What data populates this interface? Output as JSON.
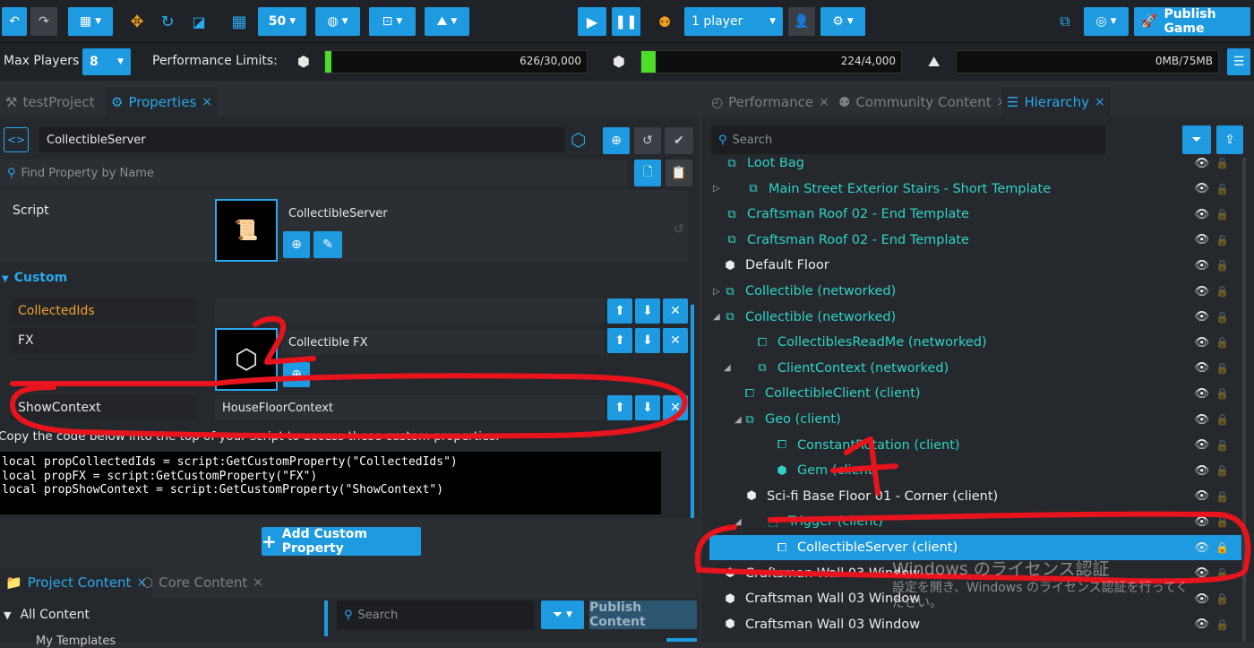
{
  "toolbar": {
    "grid_size": "50",
    "player_mode": "1 player",
    "publish_label": "Publish Game"
  },
  "perf": {
    "max_players_label": "Max Players",
    "max_players_value": "8",
    "limits_label": "Performance Limits:",
    "objects": "626/30,000",
    "objects_fraction": 0.021,
    "networked": "224/4,000",
    "networked_fraction": 0.056,
    "memory": "0MB/75MB",
    "memory_fraction": 0.0
  },
  "left_tabs": {
    "project": "testProject",
    "properties": "Properties",
    "close": "×"
  },
  "properties": {
    "object_name": "CollectibleServer",
    "find_placeholder": "Find Property by Name",
    "script_label": "Script",
    "script_value": "CollectibleServer",
    "custom_header": "Custom",
    "custom": [
      {
        "name": "CollectedIds",
        "value": ""
      },
      {
        "name": "FX",
        "value": "Collectible FX"
      },
      {
        "name": "ShowContext",
        "value": "HouseFloorContext"
      }
    ],
    "copy_note": "Copy the code below into the top of your script to access these custom properties.",
    "code": "local propCollectedIds = script:GetCustomProperty(\"CollectedIds\")\nlocal propFX = script:GetCustomProperty(\"FX\")\nlocal propShowContext = script:GetCustomProperty(\"ShowContext\")",
    "add_button": "Add Custom Property"
  },
  "bottom_tabs": {
    "project_content": "Project Content",
    "core_content": "Core Content",
    "all_content": "All Content",
    "my_templates": "My Templates",
    "search_placeholder": "Search",
    "publish_content": "Publish Content"
  },
  "right_tabs": {
    "performance": "Performance",
    "community": "Community Content",
    "hierarchy": "Hierarchy"
  },
  "hierarchy": {
    "search_placeholder": "Search",
    "items": [
      {
        "label": "Loot Bag",
        "color": "teal",
        "icon": "folder-icon"
      },
      {
        "label": "Main Street Exterior Stairs - Short Template",
        "color": "teal",
        "icon": "folder-icon"
      },
      {
        "label": "Craftsman Roof 02 - End Template",
        "color": "teal",
        "icon": "folder-icon"
      },
      {
        "label": "Craftsman Roof 02 - End Template",
        "color": "teal",
        "icon": "folder-icon"
      },
      {
        "label": "Default Floor",
        "color": "white",
        "icon": "cube-icon"
      },
      {
        "label": "Collectible (networked)",
        "color": "teal",
        "icon": "folder-icon"
      },
      {
        "label": "Collectible (networked)",
        "color": "teal",
        "icon": "folder-icon"
      },
      {
        "label": "CollectiblesReadMe (networked)",
        "color": "teal",
        "icon": "script-icon"
      },
      {
        "label": "ClientContext (networked)",
        "color": "teal",
        "icon": "folder-icon"
      },
      {
        "label": "CollectibleClient (client)",
        "color": "teal",
        "icon": "script-icon"
      },
      {
        "label": "Geo (client)",
        "color": "teal",
        "icon": "folder-icon"
      },
      {
        "label": "ConstantRotation (client)",
        "color": "teal",
        "icon": "script-icon"
      },
      {
        "label": "Gem (client)",
        "color": "teal",
        "icon": "cube-icon"
      },
      {
        "label": "Sci-fi Base Floor 01 - Corner (client)",
        "color": "white",
        "icon": "cube-icon"
      },
      {
        "label": "Trigger (client)",
        "color": "teal",
        "icon": "trigger-icon"
      },
      {
        "label": "CollectibleServer (client)",
        "color": "selected",
        "icon": "script-icon"
      },
      {
        "label": "Craftsman Wall 03 Window",
        "color": "white",
        "icon": "cube-icon"
      },
      {
        "label": "Craftsman Wall 03 Window",
        "color": "white",
        "icon": "cube-icon"
      },
      {
        "label": "Craftsman Wall 03 Window",
        "color": "white",
        "icon": "cube-icon"
      }
    ]
  },
  "annotations": {
    "mark_1": "1",
    "mark_2": "2"
  },
  "watermark": {
    "line1": "Windows のライセンス認証",
    "line2": "設定を開き、Windows のライセンス認証を行ってください。"
  }
}
